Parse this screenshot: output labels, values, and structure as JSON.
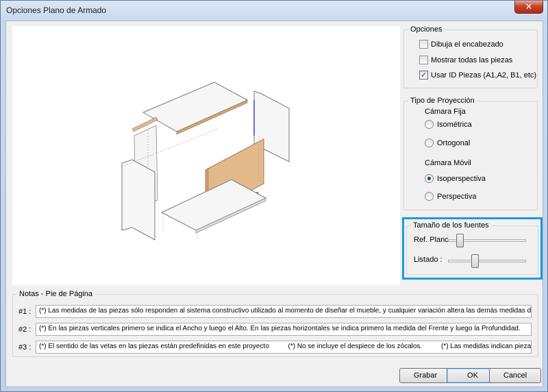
{
  "window": {
    "title": "Opciones Plano de Armado",
    "close_glyph": "✕"
  },
  "opciones": {
    "legend": "Opciones",
    "items": [
      {
        "label": "Dibuja el encabezado",
        "checked": false
      },
      {
        "label": "Mostrar todas las piezas",
        "checked": false
      },
      {
        "label": "Usar ID Piezas (A1,A2, B1, etc)",
        "checked": true
      }
    ]
  },
  "proyeccion": {
    "legend": "Tipo de Proyección",
    "camara_fija": "Cámara Fija",
    "camara_movil": "Cámara Móvil",
    "options": [
      {
        "label": "Isométrica",
        "checked": false
      },
      {
        "label": "Ortogonal",
        "checked": false
      },
      {
        "label": "Isoperspectiva",
        "checked": true
      },
      {
        "label": "Perspectiva",
        "checked": false
      }
    ]
  },
  "fuentes": {
    "legend": "Tamaño de los fuentes",
    "sliders": [
      {
        "label": "Ref. Plano",
        "level": 0.12
      },
      {
        "label": "Listado :",
        "level": 0.33
      }
    ]
  },
  "notas": {
    "legend": "Notas - Pie de Página",
    "rows": [
      {
        "label": "#1 :",
        "text": "(*) Las medidas de las piezas sólo responden al sistema constructivo utilizado al momento de diseñar el mueble, y cualquier variación altera las demás medidas de este proyecto."
      },
      {
        "label": "#2 :",
        "text": "(*) En las piezas verticales primero se indica el Ancho y luego el Alto. En las piezas horizontales se indica primero la medida del Frente y luego la Profundidad."
      },
      {
        "label": "#3 :",
        "text": "(*) El sentido de las vetas en las piezas están predefinidas en este proyecto          (*) No se incluye el despiece de los zócalos.          (*) Las medidas indican piezas terminadas con los"
      }
    ]
  },
  "buttons": {
    "grabar": "Grabar",
    "ok": "OK",
    "cancel": "Cancel"
  },
  "colors": {
    "highlight": "#1e9bdc",
    "wood": "#e3b98a"
  }
}
